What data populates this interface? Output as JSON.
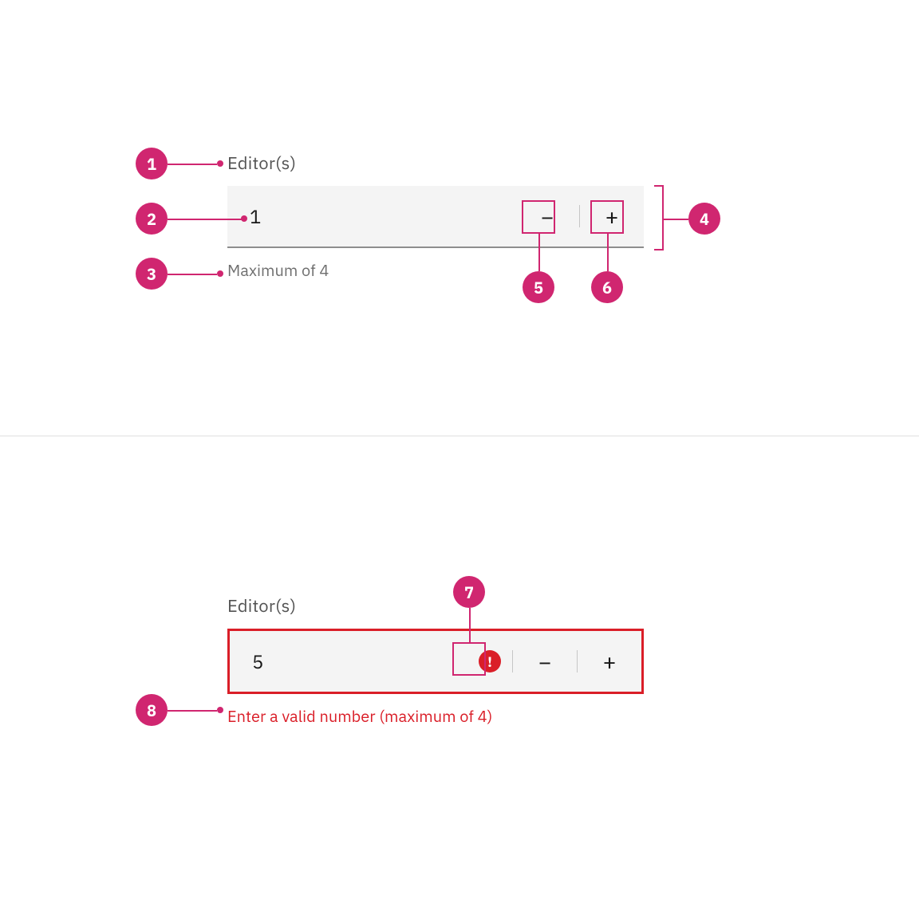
{
  "colors": {
    "accent": "#d02670",
    "error": "#da1e28"
  },
  "example1": {
    "label": "Editor(s)",
    "value": "1",
    "helper": "Maximum of 4",
    "decrement_glyph": "−",
    "increment_glyph": "+"
  },
  "example2": {
    "label": "Editor(s)",
    "value": "5",
    "error_message": "Enter a valid number (maximum of 4)",
    "decrement_glyph": "−",
    "increment_glyph": "+",
    "warning_glyph": "!"
  },
  "annotations": {
    "1": "1",
    "2": "2",
    "3": "3",
    "4": "4",
    "5": "5",
    "6": "6",
    "7": "7",
    "8": "8"
  }
}
